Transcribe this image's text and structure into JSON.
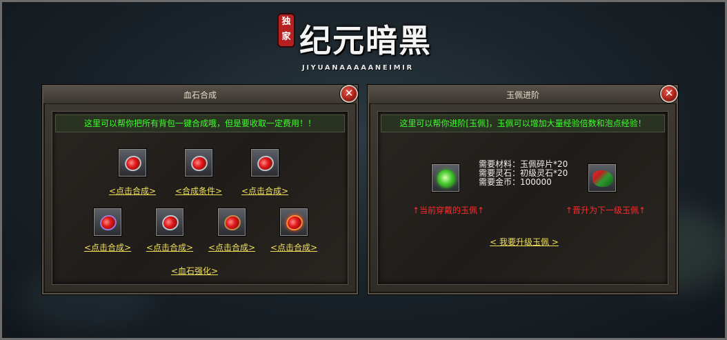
{
  "logo": {
    "badge": "独\n家",
    "title": "纪元暗黑",
    "subtitle": "JIYUANAAAAANEIMIR"
  },
  "left_panel": {
    "title": "血石合成",
    "close_label": "✕",
    "notice": "这里可以帮你把所有背包一键合成哦，但是要收取一定费用！！",
    "row1": [
      {
        "link": "<点击合成>"
      },
      {
        "link": "<合成条件>"
      },
      {
        "link": "<点击合成>"
      }
    ],
    "row2": [
      {
        "link": "<点击合成>"
      },
      {
        "link": "<点击合成>"
      },
      {
        "link": "<点击合成>"
      },
      {
        "link": "<点击合成>"
      }
    ],
    "strengthen_link": "<血石强化>"
  },
  "right_panel": {
    "title": "玉佩进阶",
    "close_label": "✕",
    "notice": "这里可以帮你进阶[玉佩]，玉佩可以增加大量经验倍数和泡点经验！",
    "requirements": [
      "需要材料：玉佩碎片*20",
      "需要灵石：初级灵石*20",
      "需要金币：100000"
    ],
    "current_label": "↑当前穿戴的玉佩↑",
    "next_label": "↑晋升为下一级玉佩↑",
    "upgrade_link": "< 我要升级玉佩 >"
  },
  "colors": {
    "notice_green": "#3dff2c",
    "link_yellow": "#f0e05a",
    "warning_red": "#ff2a2a"
  }
}
